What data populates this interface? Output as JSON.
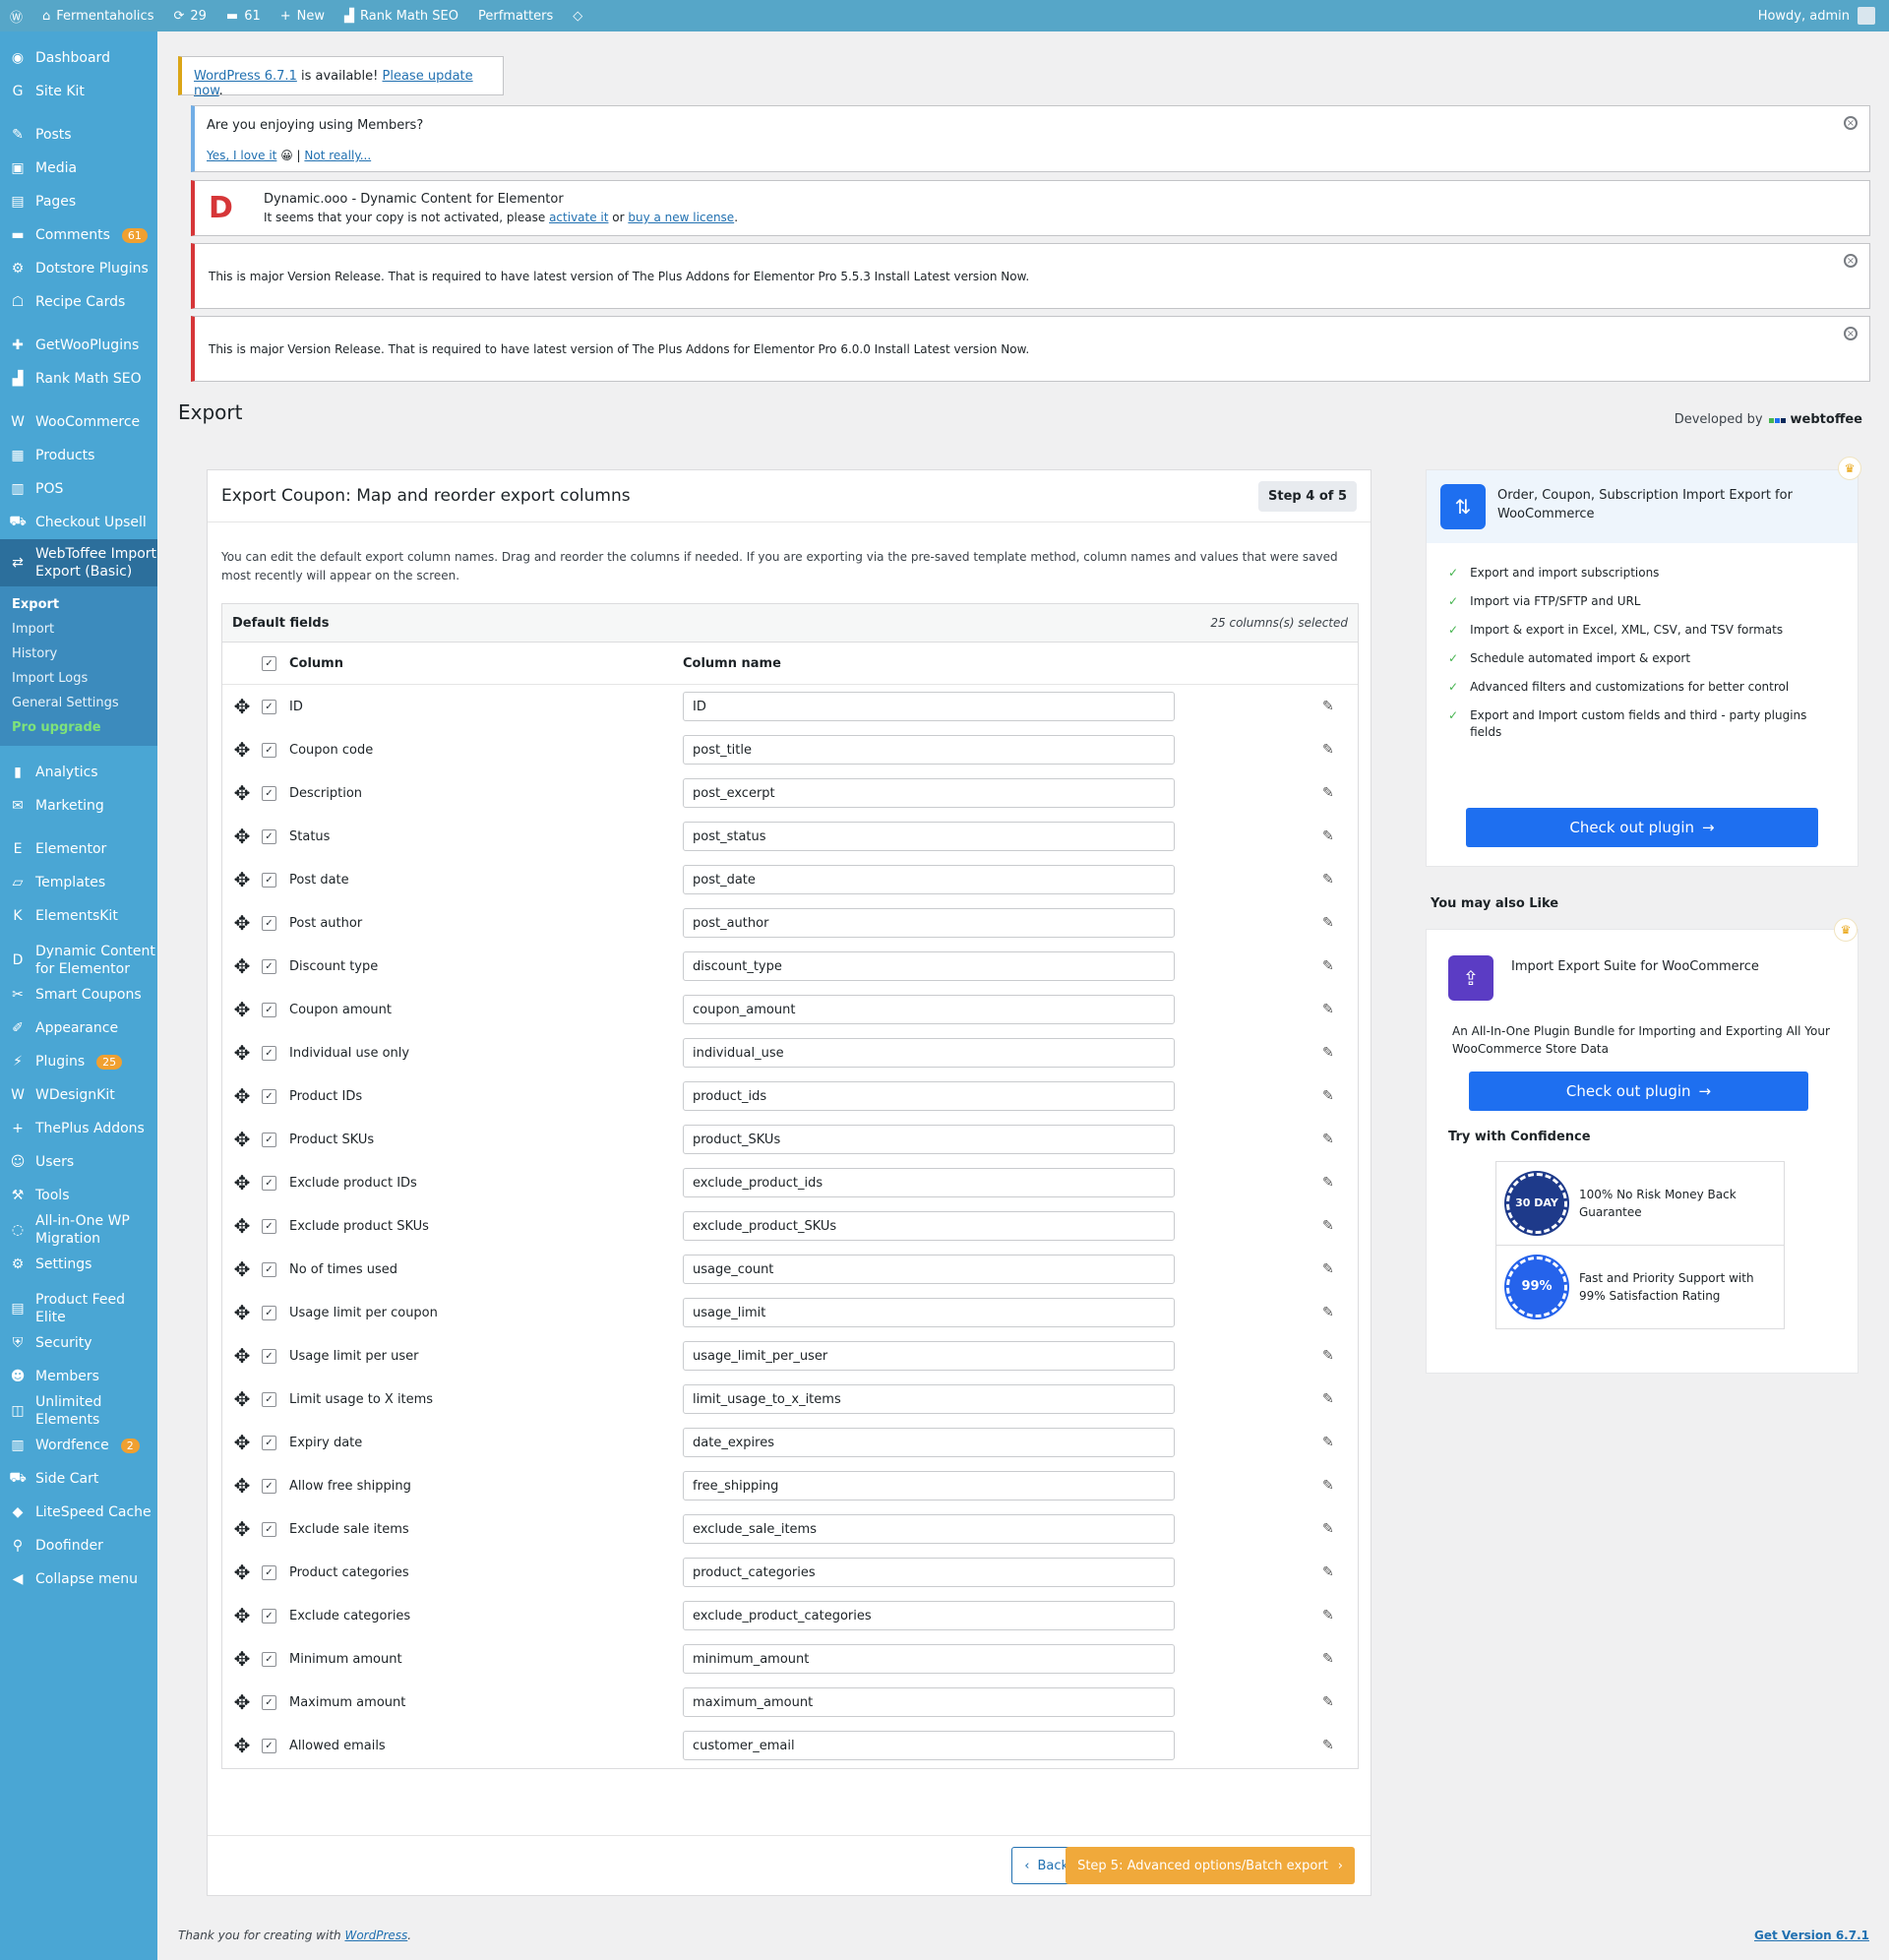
{
  "adminbar": {
    "site_name": "Fermentaholics",
    "updates_count": "29",
    "comments_count": "61",
    "new_label": "New",
    "rankmath_label": "Rank Math SEO",
    "perfmatters_label": "Perfmatters",
    "howdy": "Howdy, admin"
  },
  "sidebar": {
    "items": [
      {
        "icon": "dashboard-icon",
        "glyph": "◉",
        "label": "Dashboard"
      },
      {
        "icon": "sitekit-icon",
        "glyph": "G",
        "label": "Site Kit"
      },
      {
        "icon": "posts-icon",
        "glyph": "✎",
        "label": "Posts"
      },
      {
        "icon": "media-icon",
        "glyph": "▣",
        "label": "Media"
      },
      {
        "icon": "pages-icon",
        "glyph": "▤",
        "label": "Pages"
      },
      {
        "icon": "comments-icon",
        "glyph": "▬",
        "label": "Comments",
        "badge": "61"
      },
      {
        "icon": "dotstore-icon",
        "glyph": "⚙",
        "label": "Dotstore Plugins"
      },
      {
        "icon": "recipe-icon",
        "glyph": "☖",
        "label": "Recipe Cards"
      },
      {
        "icon": "getwoo-icon",
        "glyph": "✚",
        "label": "GetWooPlugins"
      },
      {
        "icon": "rankmath-icon",
        "glyph": "▟",
        "label": "Rank Math SEO"
      },
      {
        "icon": "woocommerce-icon",
        "glyph": "W",
        "label": "WooCommerce"
      },
      {
        "icon": "products-icon",
        "glyph": "▦",
        "label": "Products"
      },
      {
        "icon": "pos-icon",
        "glyph": "▥",
        "label": "POS"
      },
      {
        "icon": "checkout-icon",
        "glyph": "⛟",
        "label": "Checkout Upsell"
      },
      {
        "icon": "webtoffee-icon",
        "glyph": "⇄",
        "label": "WebToffee Import Export (Basic)"
      },
      {
        "icon": "analytics-icon",
        "glyph": "▮",
        "label": "Analytics"
      },
      {
        "icon": "marketing-icon",
        "glyph": "✉",
        "label": "Marketing"
      },
      {
        "icon": "elementor-icon",
        "glyph": "E",
        "label": "Elementor"
      },
      {
        "icon": "templates-icon",
        "glyph": "▱",
        "label": "Templates"
      },
      {
        "icon": "elementskit-icon",
        "glyph": "K",
        "label": "ElementsKit"
      },
      {
        "icon": "dynamic-content-icon",
        "glyph": "D",
        "label": "Dynamic Content for Elementor"
      },
      {
        "icon": "smart-coupons-icon",
        "glyph": "✂",
        "label": "Smart Coupons"
      },
      {
        "icon": "appearance-icon",
        "glyph": "✐",
        "label": "Appearance"
      },
      {
        "icon": "plugins-icon",
        "glyph": "⚡",
        "label": "Plugins",
        "badge": "25"
      },
      {
        "icon": "wdesignkit-icon",
        "glyph": "W",
        "label": "WDesignKit"
      },
      {
        "icon": "theplus-icon",
        "glyph": "+",
        "label": "ThePlus Addons"
      },
      {
        "icon": "users-icon",
        "glyph": "☺",
        "label": "Users"
      },
      {
        "icon": "tools-icon",
        "glyph": "⚒",
        "label": "Tools"
      },
      {
        "icon": "migration-icon",
        "glyph": "◌",
        "label": "All-in-One WP Migration"
      },
      {
        "icon": "settings-icon",
        "glyph": "⚙",
        "label": "Settings"
      },
      {
        "icon": "product-feed-icon",
        "glyph": "▤",
        "label": "Product Feed Elite"
      },
      {
        "icon": "security-icon",
        "glyph": "⛨",
        "label": "Security"
      },
      {
        "icon": "members-icon",
        "glyph": "☻",
        "label": "Members"
      },
      {
        "icon": "unlimited-elements-icon",
        "glyph": "◫",
        "label": "Unlimited Elements"
      },
      {
        "icon": "wordfence-icon",
        "glyph": "▥",
        "label": "Wordfence",
        "badge": "2"
      },
      {
        "icon": "side-cart-icon",
        "glyph": "⛟",
        "label": "Side Cart"
      },
      {
        "icon": "litespeed-icon",
        "glyph": "◆",
        "label": "LiteSpeed Cache"
      },
      {
        "icon": "doofinder-icon",
        "glyph": "⚲",
        "label": "Doofinder"
      },
      {
        "icon": "collapse-icon",
        "glyph": "◀",
        "label": "Collapse menu"
      }
    ],
    "submenu": [
      "Export",
      "Import",
      "History",
      "Import Logs",
      "General Settings",
      "Pro upgrade"
    ]
  },
  "notices": {
    "update": {
      "link1": "WordPress 6.7.1",
      "text": " is available! ",
      "link2": "Please update now",
      "end": "."
    },
    "members": {
      "question": "Are you enjoying using Members?",
      "yes": "Yes, I love it",
      "emoji": "😀",
      "sep": " | ",
      "no": "Not really..."
    },
    "dynamic": {
      "title": "Dynamic.ooo - Dynamic Content for Elementor",
      "text": "It seems that your copy is not activated, please ",
      "link1": "activate it",
      "mid": " or ",
      "link2": "buy a new license",
      "end": "."
    },
    "plus1": "This is major Version Release. That is required to have latest version of The Plus Addons for Elementor Pro 5.5.3 Install Latest version Now.",
    "plus2": "This is major Version Release. That is required to have latest version of The Plus Addons for Elementor Pro 6.0.0 Install Latest version Now."
  },
  "page_title": "Export",
  "developed_by": "Developed by",
  "webtoffee_brand": "webtoffee",
  "main": {
    "title": "Export Coupon: Map and reorder export columns",
    "step": "Step 4 of 5",
    "intro": "You can edit the default export column names. Drag and reorder the columns if needed. If you are exporting via the pre-saved template method, column names and values that were saved most recently will appear on the screen.",
    "fields_title": "Default fields",
    "selected_count": "25 columns(s) selected",
    "col_header": "Column",
    "colname_header": "Column name",
    "rows": [
      {
        "label": "ID",
        "name": "ID"
      },
      {
        "label": "Coupon code",
        "name": "post_title"
      },
      {
        "label": "Description",
        "name": "post_excerpt"
      },
      {
        "label": "Status",
        "name": "post_status"
      },
      {
        "label": "Post date",
        "name": "post_date"
      },
      {
        "label": "Post author",
        "name": "post_author"
      },
      {
        "label": "Discount type",
        "name": "discount_type"
      },
      {
        "label": "Coupon amount",
        "name": "coupon_amount"
      },
      {
        "label": "Individual use only",
        "name": "individual_use"
      },
      {
        "label": "Product IDs",
        "name": "product_ids"
      },
      {
        "label": "Product SKUs",
        "name": "product_SKUs"
      },
      {
        "label": "Exclude product IDs",
        "name": "exclude_product_ids"
      },
      {
        "label": "Exclude product SKUs",
        "name": "exclude_product_SKUs"
      },
      {
        "label": "No of times used",
        "name": "usage_count"
      },
      {
        "label": "Usage limit per coupon",
        "name": "usage_limit"
      },
      {
        "label": "Usage limit per user",
        "name": "usage_limit_per_user"
      },
      {
        "label": "Limit usage to X items",
        "name": "limit_usage_to_x_items"
      },
      {
        "label": "Expiry date",
        "name": "date_expires"
      },
      {
        "label": "Allow free shipping",
        "name": "free_shipping"
      },
      {
        "label": "Exclude sale items",
        "name": "exclude_sale_items"
      },
      {
        "label": "Product categories",
        "name": "product_categories"
      },
      {
        "label": "Exclude categories",
        "name": "exclude_product_categories"
      },
      {
        "label": "Minimum amount",
        "name": "minimum_amount"
      },
      {
        "label": "Maximum amount",
        "name": "maximum_amount"
      },
      {
        "label": "Allowed emails",
        "name": "customer_email"
      }
    ],
    "back_label": "Back",
    "next_label": "Step 5: Advanced options/Batch export"
  },
  "promo": {
    "title": "Order, Coupon, Subscription Import Export for WooCommerce",
    "features": [
      "Export and import subscriptions",
      "Import via FTP/SFTP and URL",
      "Import & export in Excel, XML, CSV, and TSV formats",
      "Schedule automated import & export",
      "Advanced filters and customizations for better control",
      "Export and Import custom fields and third - party plugins fields"
    ],
    "button": "Check out plugin"
  },
  "also_like": {
    "heading": "You may also Like",
    "title": "Import Export Suite for WooCommerce",
    "desc": "An All-In-One Plugin Bundle for Importing and Exporting All Your WooCommerce Store Data",
    "button": "Check out plugin",
    "try_title": "Try with Confidence",
    "money_back": "100% No Risk Money Back Guarantee",
    "money_seal": "30 DAY",
    "support": "Fast and Priority Support with 99% Satisfaction Rating",
    "support_seal": "99%"
  },
  "footer": {
    "thanks": "Thank you for creating with ",
    "wp_link": "WordPress",
    "end": ".",
    "version_link": "Get Version 6.7.1"
  },
  "colors": {
    "adminbar": "#56a6c8",
    "sidebar": "#4aa6d4",
    "primary_button": "#1e6ff0",
    "next_button": "#f0a93b",
    "check": "#46b450"
  }
}
